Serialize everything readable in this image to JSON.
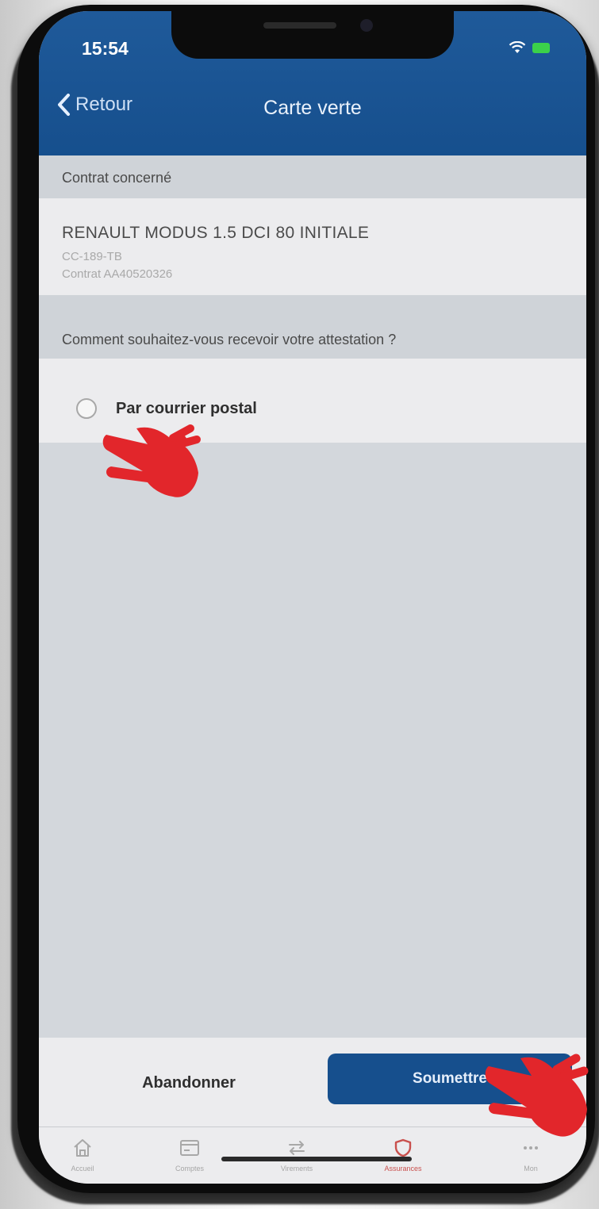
{
  "status_bar": {
    "time": "15:54"
  },
  "nav": {
    "back_label": "Retour",
    "title": "Carte verte"
  },
  "contract_section": {
    "header": "Contrat concerné",
    "vehicle": "RENAULT MODUS 1.5 DCI 80 INITIALE",
    "plate": "CC-189-TB",
    "contract_number": "Contrat AA40520326"
  },
  "delivery_section": {
    "header": "Comment souhaitez-vous recevoir votre attestation ?",
    "options": [
      {
        "label": "Par courrier postal",
        "selected": false
      }
    ]
  },
  "actions": {
    "cancel_label": "Abandonner",
    "submit_label": "Soumettre"
  },
  "tab_bar": {
    "items": [
      {
        "label": "Accueil",
        "icon": "home-icon",
        "active": false
      },
      {
        "label": "Comptes",
        "icon": "card-icon",
        "active": false
      },
      {
        "label": "Virements",
        "icon": "transfer-icon",
        "active": false
      },
      {
        "label": "Assurances",
        "icon": "shield-icon",
        "active": true
      },
      {
        "label": "Mon",
        "icon": "more-icon",
        "active": false
      }
    ]
  },
  "colors": {
    "brand_blue": "#164f8d",
    "active_tab": "#c9504d",
    "pointer_hand": "#e2262b"
  }
}
